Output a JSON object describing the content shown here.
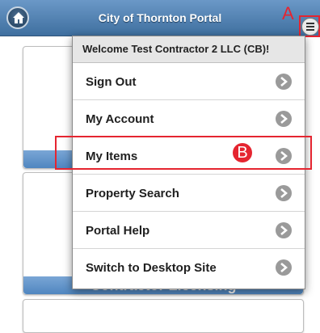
{
  "header": {
    "title": "City of Thornton Portal",
    "home_icon": "home-icon",
    "menu_icon": "hamburger-menu-icon"
  },
  "annotations": {
    "a": "A",
    "b": "B"
  },
  "background": {
    "tile_label": "Contractor Licensing"
  },
  "menu": {
    "welcome": "Welcome Test Contractor 2 LLC (CB)!",
    "items": [
      {
        "label": "Sign Out"
      },
      {
        "label": "My Account"
      },
      {
        "label": "My Items"
      },
      {
        "label": "Property Search"
      },
      {
        "label": "Portal Help"
      },
      {
        "label": "Switch to Desktop Site"
      }
    ]
  },
  "colors": {
    "header": "#4f7fb0",
    "callout": "#e52530",
    "tile_bar": "#5b8ec6"
  }
}
